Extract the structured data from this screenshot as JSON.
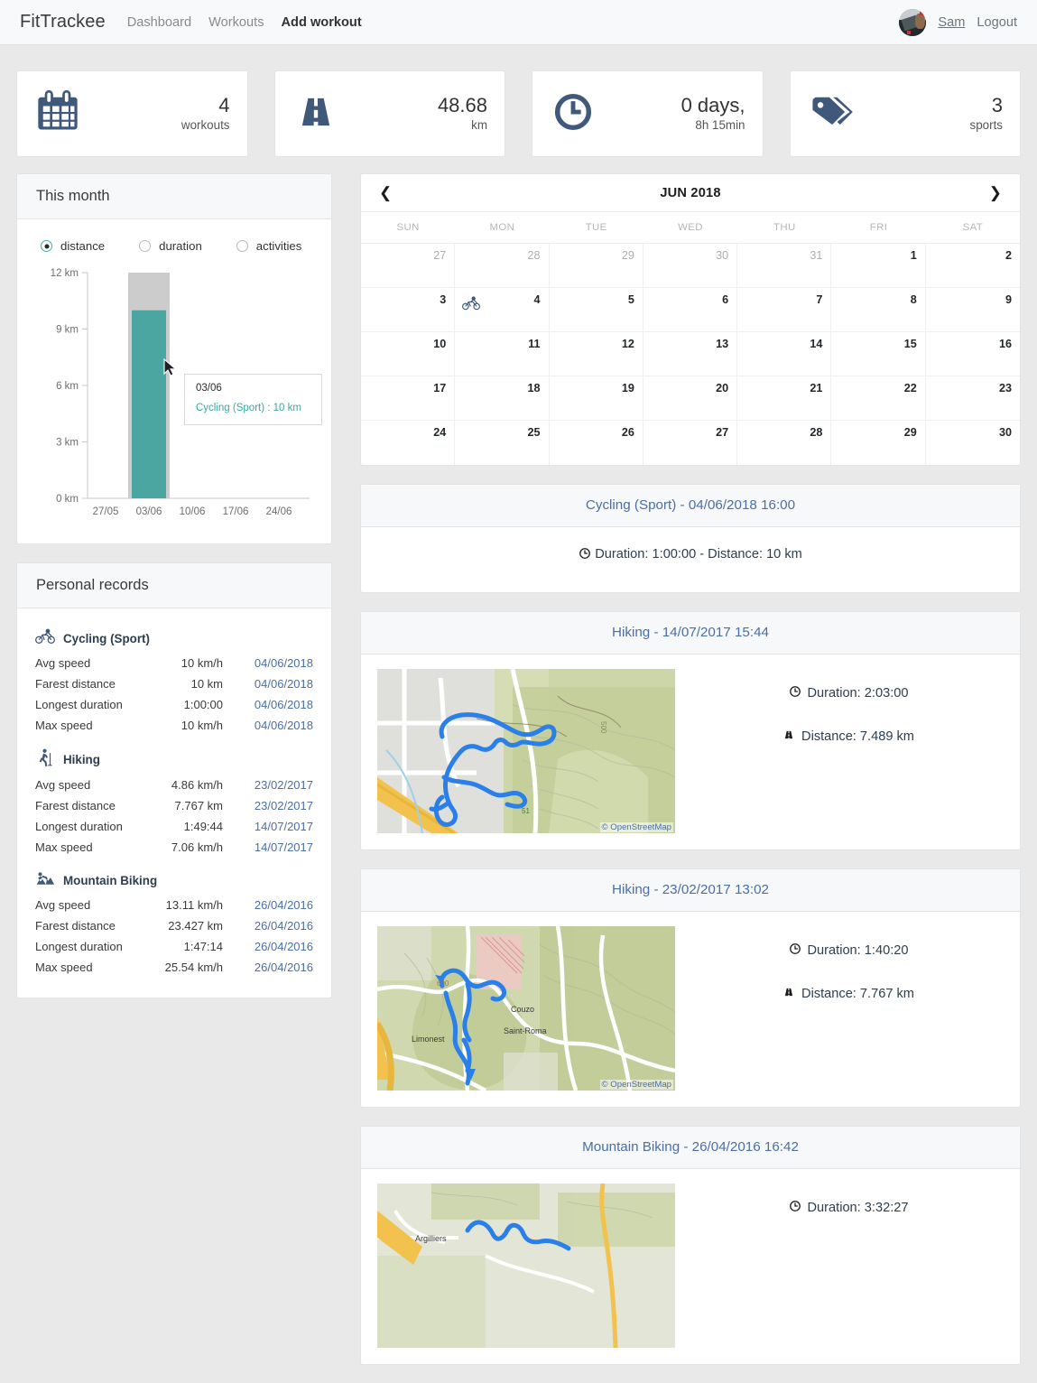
{
  "header": {
    "brand": "FitTrackee",
    "nav": [
      {
        "label": "Dashboard",
        "active": false
      },
      {
        "label": "Workouts",
        "active": false
      },
      {
        "label": "Add workout",
        "active": true
      }
    ],
    "user": "Sam",
    "logout": "Logout",
    "avatar_icon": "user-avatar-photo"
  },
  "stats": [
    {
      "icon": "calendar-icon",
      "value": "4",
      "label": "workouts"
    },
    {
      "icon": "road-icon",
      "value": "48.68",
      "label": "km"
    },
    {
      "icon": "clock-icon",
      "value": "0 days,",
      "label": "8h 15min"
    },
    {
      "icon": "tags-icon",
      "value": "3",
      "label": "sports"
    }
  ],
  "this_month": {
    "title": "This month",
    "options": [
      {
        "label": "distance",
        "selected": true
      },
      {
        "label": "duration",
        "selected": false
      },
      {
        "label": "activities",
        "selected": false
      }
    ],
    "tooltip": {
      "date": "03/06",
      "value": "Cycling (Sport) : 10 km"
    }
  },
  "chart_data": {
    "type": "bar",
    "title": "This month",
    "categories": [
      "27/05",
      "03/06",
      "10/06",
      "17/06",
      "24/06"
    ],
    "values": [
      0,
      10,
      0,
      0,
      0
    ],
    "series": [
      {
        "name": "Cycling (Sport)",
        "values": [
          0,
          10,
          0,
          0,
          0
        ]
      }
    ],
    "xlabel": "",
    "ylabel": "distance",
    "ylim": [
      0,
      12
    ],
    "yticks": [
      0,
      3,
      6,
      9,
      12
    ],
    "ytick_labels": [
      "0 km",
      "3 km",
      "6 km",
      "9 km",
      "12 km"
    ],
    "unit": "km",
    "grid": false,
    "legend": "none",
    "bar_color": "#4ba5a0",
    "hover_color": "#cccccc",
    "hover_category": "03/06",
    "hover_value": 10
  },
  "personal_records": {
    "title": "Personal records",
    "row_labels": [
      "Avg speed",
      "Farest distance",
      "Longest duration",
      "Max speed"
    ],
    "groups": [
      {
        "sport": "Cycling (Sport)",
        "icon": "cycling-icon",
        "rows": [
          {
            "label": "Avg speed",
            "value": "10 km/h",
            "date": "04/06/2018"
          },
          {
            "label": "Farest distance",
            "value": "10 km",
            "date": "04/06/2018"
          },
          {
            "label": "Longest duration",
            "value": "1:00:00",
            "date": "04/06/2018"
          },
          {
            "label": "Max speed",
            "value": "10 km/h",
            "date": "04/06/2018"
          }
        ]
      },
      {
        "sport": "Hiking",
        "icon": "hiking-icon",
        "rows": [
          {
            "label": "Avg speed",
            "value": "4.86 km/h",
            "date": "23/02/2017"
          },
          {
            "label": "Farest distance",
            "value": "7.767 km",
            "date": "23/02/2017"
          },
          {
            "label": "Longest duration",
            "value": "1:49:44",
            "date": "14/07/2017"
          },
          {
            "label": "Max speed",
            "value": "7.06 km/h",
            "date": "14/07/2017"
          }
        ]
      },
      {
        "sport": "Mountain Biking",
        "icon": "mountain-biking-icon",
        "rows": [
          {
            "label": "Avg speed",
            "value": "13.11 km/h",
            "date": "26/04/2016"
          },
          {
            "label": "Farest distance",
            "value": "23.427 km",
            "date": "26/04/2016"
          },
          {
            "label": "Longest duration",
            "value": "1:47:14",
            "date": "26/04/2016"
          },
          {
            "label": "Max speed",
            "value": "25.54 km/h",
            "date": "26/04/2016"
          }
        ]
      }
    ]
  },
  "calendar": {
    "title": "JUN 2018",
    "prev_icon": "chevron-left-icon",
    "next_icon": "chevron-right-icon",
    "weekdays": [
      "SUN",
      "MON",
      "TUE",
      "WED",
      "THU",
      "FRI",
      "SAT"
    ],
    "days": [
      {
        "n": "27",
        "muted": true
      },
      {
        "n": "28",
        "muted": true
      },
      {
        "n": "29",
        "muted": true
      },
      {
        "n": "30",
        "muted": true
      },
      {
        "n": "31",
        "muted": true
      },
      {
        "n": "1",
        "muted": false
      },
      {
        "n": "2",
        "muted": false
      },
      {
        "n": "3",
        "muted": false
      },
      {
        "n": "4",
        "muted": false,
        "event": "cycling-icon"
      },
      {
        "n": "5",
        "muted": false
      },
      {
        "n": "6",
        "muted": false
      },
      {
        "n": "7",
        "muted": false
      },
      {
        "n": "8",
        "muted": false
      },
      {
        "n": "9",
        "muted": false
      },
      {
        "n": "10",
        "muted": false
      },
      {
        "n": "11",
        "muted": false
      },
      {
        "n": "12",
        "muted": false
      },
      {
        "n": "13",
        "muted": false
      },
      {
        "n": "14",
        "muted": false
      },
      {
        "n": "15",
        "muted": false
      },
      {
        "n": "16",
        "muted": false
      },
      {
        "n": "17",
        "muted": false
      },
      {
        "n": "18",
        "muted": false
      },
      {
        "n": "19",
        "muted": false
      },
      {
        "n": "20",
        "muted": false
      },
      {
        "n": "21",
        "muted": false
      },
      {
        "n": "22",
        "muted": false
      },
      {
        "n": "23",
        "muted": false
      },
      {
        "n": "24",
        "muted": false
      },
      {
        "n": "25",
        "muted": false
      },
      {
        "n": "26",
        "muted": false
      },
      {
        "n": "27",
        "muted": false
      },
      {
        "n": "28",
        "muted": false
      },
      {
        "n": "29",
        "muted": false
      },
      {
        "n": "30",
        "muted": false
      }
    ]
  },
  "workouts": [
    {
      "title": "Cycling (Sport) - 04/06/2018 16:00",
      "has_map": false,
      "inline": "Duration: 1:00:00 - Distance: 10 km",
      "duration_label": "Duration: 1:00:00",
      "distance_label": "Distance: 10 km",
      "map_credit": ""
    },
    {
      "title": "Hiking - 14/07/2017 15:44",
      "has_map": true,
      "duration_label": "Duration: 2:03:00",
      "distance_label": "Distance: 7.489 km",
      "map_credit": "© OpenStreetMap",
      "map_labels": [
        "51"
      ]
    },
    {
      "title": "Hiking - 23/02/2017 13:02",
      "has_map": true,
      "duration_label": "Duration: 1:40:20",
      "distance_label": "Distance: 7.767 km",
      "map_credit": "© OpenStreetMap",
      "map_labels": [
        "Limonest",
        "Couzo",
        "Saint-Roma",
        "600"
      ]
    },
    {
      "title": "Mountain Biking - 26/04/2016 16:42",
      "has_map": true,
      "duration_label": "Duration: 3:32:27",
      "distance_label": "",
      "map_credit": "",
      "map_labels": [
        "Argilliers"
      ]
    }
  ],
  "colors": {
    "icon_slate": "#40587a",
    "link_blue": "#4a6fa5",
    "teal": "#4ba5a0",
    "track_blue": "#2a7fe8"
  }
}
